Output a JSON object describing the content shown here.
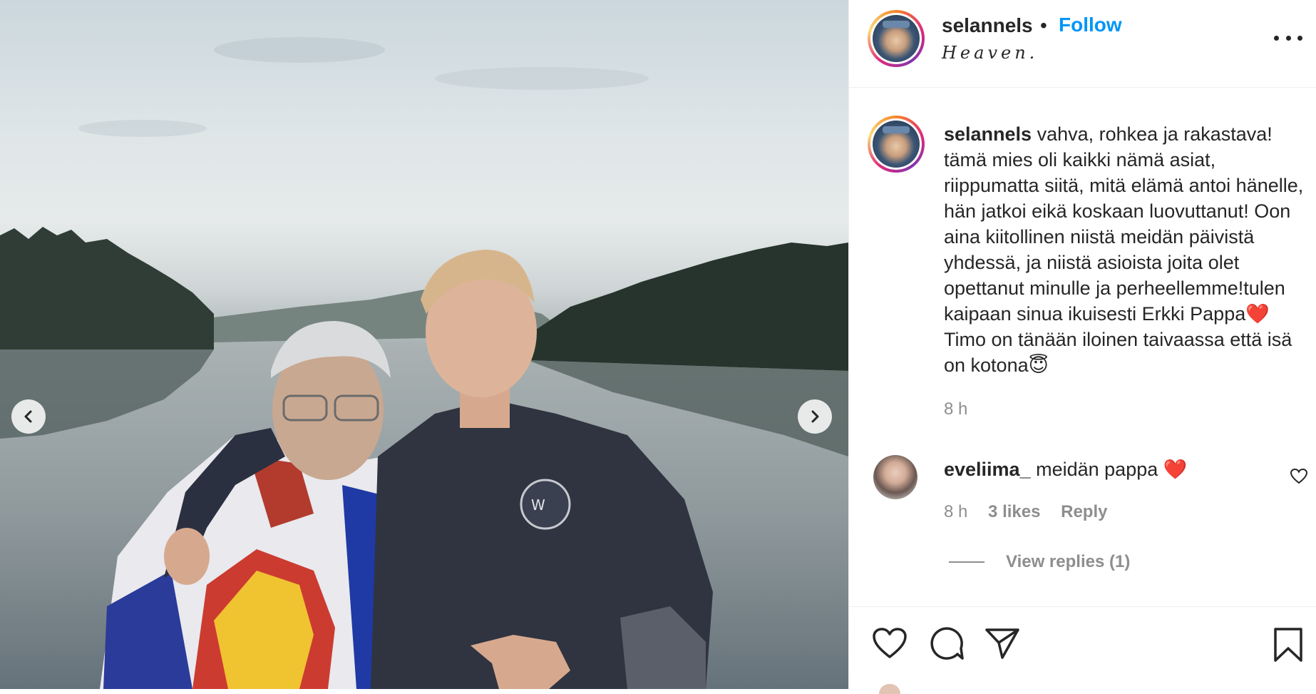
{
  "post": {
    "username": "selannels",
    "separator": "•",
    "follow_label": "Follow",
    "location": "Heaven."
  },
  "caption": {
    "username": "selannels",
    "text": "vahva, rohkea ja rakastava! tämä mies oli kaikki nämä asiat, riippumatta siitä, mitä elämä antoi hänelle, hän jatkoi eikä koskaan luovuttanut! Oon aina kiitollinen niistä meidän päivistä yhdessä, ja niistä asioista joita olet opettanut minulle ja perheellemme!tulen kaipaan sinua ikuisesti Erkki Pappa❤️Timo on tänään iloinen taivaassa että isä on kotona😇",
    "time": "8 h"
  },
  "comments": [
    {
      "username": "eveliima_",
      "text": "meidän pappa ❤️",
      "time": "8 h",
      "likes": "3 likes",
      "reply_label": "Reply",
      "view_replies": "View replies (1)"
    }
  ],
  "icons": {
    "prev": "chevron-left-icon",
    "next": "chevron-right-icon",
    "more": "more-options-icon",
    "like": "heart-icon",
    "comment": "comment-icon",
    "share": "paper-plane-icon",
    "save": "bookmark-icon"
  },
  "colors": {
    "follow": "#0095f6",
    "muted": "#8e8e8e",
    "text": "#262626"
  }
}
